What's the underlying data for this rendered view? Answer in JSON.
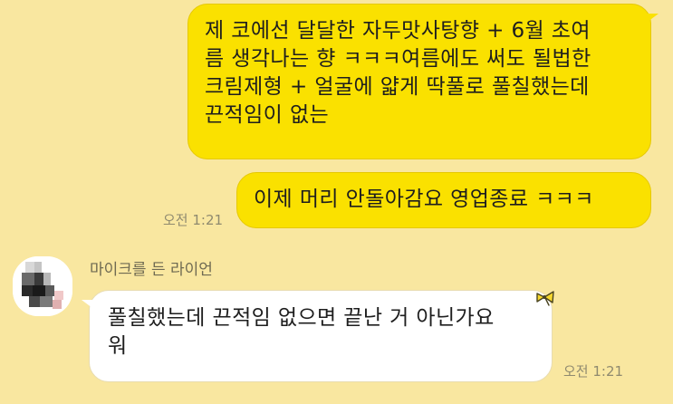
{
  "messages": {
    "outgoing_1": {
      "lines": [
        "제 코에선 달달한 자두맛사탕향 + 6월 초여",
        "름 생각나는 향 ㅋㅋㅋ여름에도 써도 될법한",
        "크림제형 + 얼굴에 얇게 딱풀로 풀칠했는데",
        "끈적임이 없는"
      ]
    },
    "outgoing_2": {
      "text": "이제 머리 안돌아감요 영업종료 ㅋㅋㅋ",
      "time": "오전 1:21"
    },
    "incoming_1": {
      "sender": "마이크를 든 라이언",
      "lines": [
        "풀칠했는데 끈적임 없으면 끝난 거 아닌가요",
        "워"
      ],
      "time": "오전 1:21"
    }
  },
  "icons": {
    "avatar": "avatar-blurred-icon",
    "reaction": "reaction-bow-icon"
  },
  "colors": {
    "background": "#f9e7a0",
    "outgoing_bubble": "#fae100",
    "incoming_bubble": "#ffffff"
  }
}
